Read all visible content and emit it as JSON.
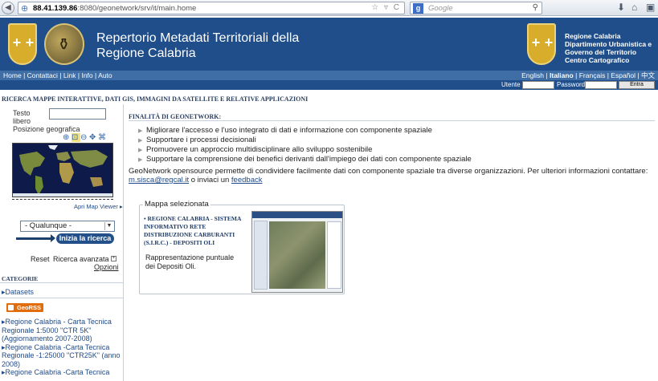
{
  "browser": {
    "url_host": "88.41.139.86",
    "url_rest": ":8080/geonetwork/srv/it/main.home",
    "search_placeholder": "Google",
    "search_engine_letter": "g"
  },
  "header": {
    "title_line1": "Repertorio Metadati Territoriali della",
    "title_line2": "Regione Calabria",
    "right_line1": "Regione Calabria",
    "right_line2": "Dipartimento Urbanistica e",
    "right_line3": "Governo del Territorio",
    "right_line4": "Centro Cartografico"
  },
  "nav": {
    "home": "Home",
    "contact": "Contattaci",
    "links": "Link",
    "info": "Info",
    "auto": "Auto",
    "sep": "|",
    "lang_en": "English",
    "lang_it": "Italiano",
    "lang_fr": "Français",
    "lang_es": "Español",
    "lang_zh": "中文"
  },
  "login": {
    "user_label": "Utente",
    "password_label": "Password",
    "enter_label": "Entra"
  },
  "subheading": "RICERCA MAPPE INTERATTIVE, DATI GIS, IMMAGINI DA SATELLITE E RELATIVE APPLICAZIONI",
  "search": {
    "text_label_1": "Testo",
    "text_label_2": "libero",
    "geo_label": "Posizione geografica",
    "open_map_viewer": "Apri Map Viewer ▸",
    "region_select": "- Qualunque -",
    "search_button": "Inizia la ricerca",
    "reset": "Reset",
    "advanced": "Ricerca avanzata",
    "options": "Opzioni"
  },
  "categories": {
    "heading": "CATEGORIE",
    "datasets": "Datasets",
    "georss_label": "GeoRSS",
    "georss_items": [
      "Regione Calabria - Carta Tecnica Regionale 1:5000 \"CTR 5K\" (Aggiornamento 2007-2008)",
      "Regione Calabria -Carta Tecnica Regionale -1:25000 \"CTR25K\" (anno 2008)",
      "Regione Calabria -Carta Tecnica"
    ]
  },
  "main": {
    "purpose_title": "FINALITÀ DI GEONETWORK:",
    "bullets": [
      "Migliorare l'accesso e l'uso integrato di dati e informazione con componente spaziale",
      "Supportare i processi decisionali",
      "Promuovere un approccio multidisciplinare allo sviluppo sostenibile",
      "Supportare la comprensione dei benefici derivanti dall'impiego dei dati con componente spaziale"
    ],
    "intro_text": "GeoNetwork opensource permette di condividere facilmente dati con componente spaziale tra diverse organizzazioni. Per ulteriori informazioni contattare:",
    "contact_email": "m.sisca@regcal.it",
    "intro_or": "o inviaci un",
    "feedback_link": "feedback",
    "selected_map_legend": "Mappa selezionata",
    "selected_map_title": "REGIONE CALABRIA - SISTEMA INFORMATIVO RETE DISTRIBUZIONE CARBURANTI (S.I.R.C.) - DEPOSITI OLI",
    "selected_map_desc": "Rappresentazione puntuale dei Depositi Oli."
  }
}
